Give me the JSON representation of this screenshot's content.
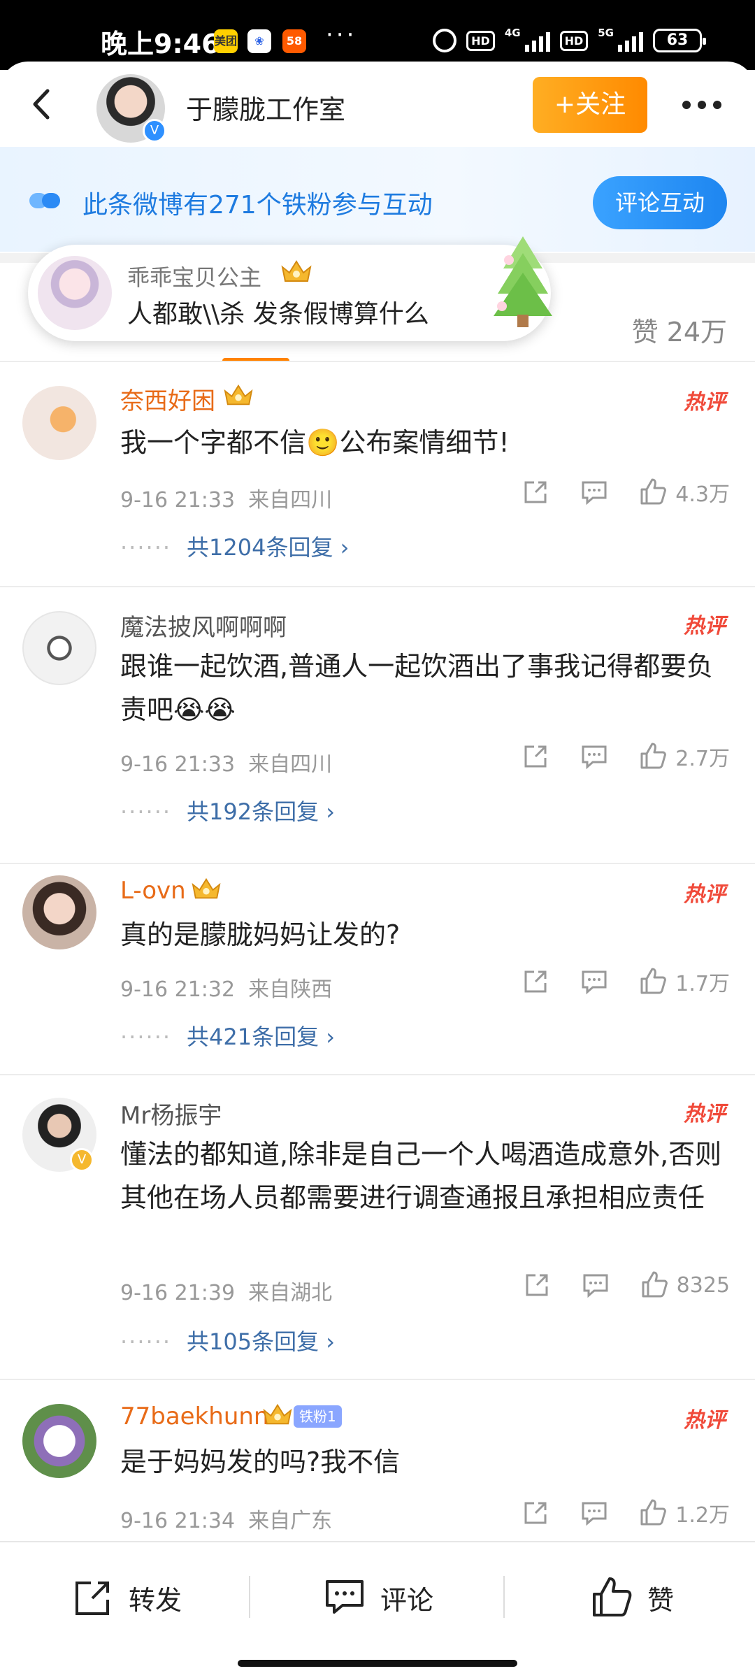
{
  "status_bar": {
    "time": "晚上9:46",
    "apps": [
      "美团",
      "百度",
      "58"
    ],
    "more": "···",
    "net1": "4G",
    "net2": "5G",
    "hd": "HD",
    "battery": "63"
  },
  "header": {
    "title": "于朦胧工作室",
    "follow_label": "+关注",
    "verified": "V"
  },
  "fan_banner": {
    "text": "此条微博有271个铁粉参与互动",
    "button": "评论互动"
  },
  "floating_comment": {
    "user": "乖乖宝贝公主",
    "text": "人都敢\\\\杀 发条假博算什么"
  },
  "tabs": {
    "likes": "赞 24万"
  },
  "hot_tag": "热评",
  "comments": [
    {
      "user": "奈西好困",
      "text": "我一个字都不信🙂公布案情细节!",
      "time": "9-16 21:33",
      "location": "来自四川",
      "likes": "4.3万",
      "replies": "共1204条回复 ›"
    },
    {
      "user": "魔法披风啊啊啊",
      "text": "跟谁一起饮酒,普通人一起饮酒出了事我记得都要负责吧😭😭",
      "time": "9-16 21:33",
      "location": "来自四川",
      "likes": "2.7万",
      "replies": "共192条回复 ›"
    },
    {
      "user": "L-ovn",
      "text": "真的是朦胧妈妈让发的?",
      "time": "9-16 21:32",
      "location": "来自陕西",
      "likes": "1.7万",
      "replies": "共421条回复 ›"
    },
    {
      "user": "Mr杨振宇",
      "text": "懂法的都知道,除非是自己一个人喝酒造成意外,否则其他在场人员都需要进行调查通报且承担相应责任",
      "time": "9-16 21:39",
      "location": "来自湖北",
      "likes": "8325",
      "replies": "共105条回复 ›"
    },
    {
      "user": "77baekhunn",
      "fan_badge": "铁粉1",
      "text": "是于妈妈发的吗?我不信",
      "time": "9-16 21:34",
      "location": "来自广东",
      "likes": "1.2万"
    }
  ],
  "bottom_bar": {
    "repost": "转发",
    "comment": "评论",
    "like": "赞"
  },
  "colors": {
    "accent_orange": "#ff8200",
    "link_blue": "#3e6ea8",
    "hot_red": "#f04a3a"
  }
}
